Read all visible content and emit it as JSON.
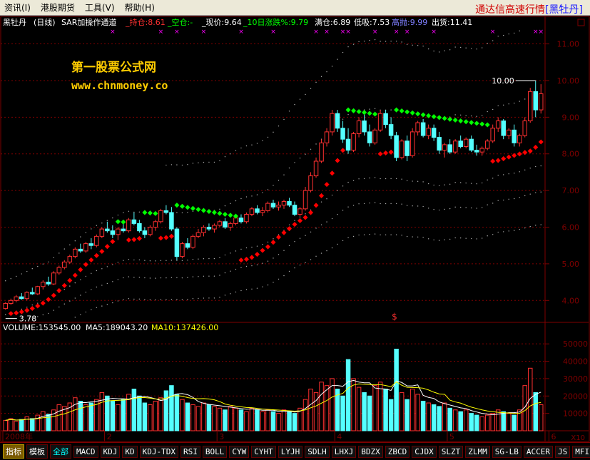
{
  "menu": [
    {
      "label": "资讯(I)"
    },
    {
      "label": "港股期货"
    },
    {
      "label": "工具(V)"
    },
    {
      "label": "帮助(H)"
    }
  ],
  "app_title": {
    "main": "通达信高速行情",
    "stock": "[黑牡丹]"
  },
  "upper_header": {
    "stock_name": "黑牡丹",
    "period": "(日线)",
    "indicator": "SAR加操作通道",
    "hold": "_持仓:8.61",
    "empty": "_空仓:-",
    "price": "_现价:9.64",
    "change10": "_10日涨跌%:9.79",
    "full": "满仓:6.89",
    "low": "低吸:7.53",
    "high_throw": "高抛:9.99",
    "out": "出货:11.41"
  },
  "watermark": {
    "line1": "第一股票公式网",
    "line2": "www.chnmoney.co"
  },
  "upper_labels": {
    "max": "10.00",
    "min": "3.78",
    "signal": "$"
  },
  "lower_header": {
    "volume": "VOLUME:153545.00",
    "ma5": "MA5:189043.20",
    "ma10": "MA10:137426.00"
  },
  "price_axis": [
    "11.00",
    "10.00",
    "9.00",
    "8.00",
    "7.00",
    "6.00",
    "5.00",
    "4.00"
  ],
  "volume_axis": [
    "50000",
    "40000",
    "30000",
    "20000",
    "10000"
  ],
  "volume_unit": "X10",
  "date_axis": [
    {
      "label": "2008年",
      "idx": 0
    },
    {
      "label": "2",
      "idx": 19
    },
    {
      "label": "3",
      "idx": 40
    },
    {
      "label": "4",
      "idx": 62
    },
    {
      "label": "5",
      "idx": 83
    },
    {
      "label": "6",
      "idx": 102
    }
  ],
  "tabs": [
    "指标",
    "模板",
    "全部",
    "MACD",
    "KDJ",
    "KD",
    "KDJ-TDX",
    "RSI",
    "BOLL",
    "CYW",
    "CYHT",
    "LYJH",
    "SDLH",
    "LHXJ",
    "BDZX",
    "ZBCD",
    "CJDX",
    "SLZT",
    "ZLMM",
    "SG-LB",
    "ACCER",
    "JS",
    "MFI"
  ],
  "colors": {
    "up": "#ff3030",
    "down": "#54ffff",
    "grid": "#800000",
    "ma5": "#ffffff",
    "ma10": "#ffff00",
    "sar_long": "#ff0000",
    "sar_short": "#00ff00",
    "marker": "#ff00ff",
    "channel": "#aaaaaa"
  },
  "chart_data": {
    "type": "candlestick",
    "price_ylim": [
      3.5,
      11.4
    ],
    "volume_ylim": [
      0,
      55000
    ],
    "series": [
      {
        "name": "candles",
        "values": [
          [
            3.78,
            3.95,
            3.75,
            3.92
          ],
          [
            3.92,
            4.05,
            3.88,
            4.0
          ],
          [
            4.0,
            4.15,
            3.95,
            4.1
          ],
          [
            4.1,
            4.2,
            4.02,
            4.05
          ],
          [
            4.05,
            4.25,
            4.0,
            4.22
          ],
          [
            4.22,
            4.35,
            4.15,
            4.18
          ],
          [
            4.18,
            4.4,
            4.15,
            4.38
          ],
          [
            4.38,
            4.55,
            4.3,
            4.5
          ],
          [
            4.5,
            4.65,
            4.4,
            4.45
          ],
          [
            4.45,
            4.8,
            4.42,
            4.75
          ],
          [
            4.75,
            4.95,
            4.7,
            4.9
          ],
          [
            4.9,
            5.1,
            4.85,
            5.05
          ],
          [
            5.05,
            5.25,
            5.0,
            5.2
          ],
          [
            5.2,
            5.45,
            5.15,
            5.4
          ],
          [
            5.4,
            5.55,
            5.3,
            5.35
          ],
          [
            5.35,
            5.6,
            5.3,
            5.55
          ],
          [
            5.55,
            5.7,
            5.4,
            5.5
          ],
          [
            5.5,
            5.8,
            5.45,
            5.75
          ],
          [
            5.75,
            6.0,
            5.7,
            5.95
          ],
          [
            5.95,
            6.15,
            5.85,
            5.9
          ],
          [
            5.9,
            6.05,
            5.7,
            5.8
          ],
          [
            5.8,
            6.0,
            5.65,
            5.95
          ],
          [
            5.95,
            6.1,
            5.85,
            5.9
          ],
          [
            5.9,
            6.25,
            5.85,
            6.2
          ],
          [
            6.2,
            6.4,
            6.05,
            6.1
          ],
          [
            6.1,
            6.2,
            5.85,
            5.9
          ],
          [
            5.9,
            6.0,
            5.7,
            5.8
          ],
          [
            5.8,
            6.05,
            5.75,
            6.0
          ],
          [
            6.0,
            6.2,
            5.9,
            6.15
          ],
          [
            6.15,
            6.5,
            6.1,
            6.45
          ],
          [
            6.45,
            6.6,
            6.35,
            6.4
          ],
          [
            6.4,
            6.55,
            5.9,
            5.95
          ],
          [
            5.95,
            6.0,
            5.1,
            5.2
          ],
          [
            5.2,
            5.6,
            5.15,
            5.55
          ],
          [
            5.55,
            5.7,
            5.4,
            5.45
          ],
          [
            5.45,
            5.8,
            5.4,
            5.75
          ],
          [
            5.75,
            5.95,
            5.7,
            5.85
          ],
          [
            5.85,
            6.05,
            5.75,
            6.0
          ],
          [
            6.0,
            6.1,
            5.9,
            5.95
          ],
          [
            5.95,
            6.1,
            5.85,
            6.05
          ],
          [
            6.05,
            6.2,
            6.0,
            6.15
          ],
          [
            6.15,
            6.25,
            5.95,
            6.0
          ],
          [
            6.0,
            6.15,
            5.9,
            6.1
          ],
          [
            6.1,
            6.3,
            6.05,
            6.25
          ],
          [
            6.25,
            6.35,
            6.1,
            6.15
          ],
          [
            6.15,
            6.4,
            6.1,
            6.35
          ],
          [
            6.35,
            6.55,
            6.3,
            6.5
          ],
          [
            6.5,
            6.6,
            6.35,
            6.4
          ],
          [
            6.4,
            6.55,
            6.3,
            6.45
          ],
          [
            6.45,
            6.7,
            6.4,
            6.65
          ],
          [
            6.65,
            6.75,
            6.5,
            6.55
          ],
          [
            6.55,
            6.7,
            6.45,
            6.6
          ],
          [
            6.6,
            6.75,
            6.5,
            6.7
          ],
          [
            6.7,
            6.8,
            6.55,
            6.6
          ],
          [
            6.6,
            6.7,
            6.3,
            6.35
          ],
          [
            6.35,
            6.55,
            6.3,
            6.5
          ],
          [
            6.5,
            7.1,
            6.45,
            7.0
          ],
          [
            7.0,
            7.5,
            6.95,
            7.4
          ],
          [
            7.4,
            7.9,
            7.35,
            7.8
          ],
          [
            7.8,
            8.4,
            7.75,
            8.3
          ],
          [
            8.3,
            8.7,
            8.2,
            8.6
          ],
          [
            8.6,
            9.2,
            8.5,
            9.1
          ],
          [
            9.1,
            9.2,
            8.6,
            8.7
          ],
          [
            8.7,
            8.9,
            8.3,
            8.4
          ],
          [
            8.4,
            8.7,
            8.0,
            8.1
          ],
          [
            8.1,
            8.6,
            8.05,
            8.55
          ],
          [
            8.55,
            9.0,
            8.45,
            8.9
          ],
          [
            8.9,
            9.1,
            8.5,
            8.6
          ],
          [
            8.6,
            8.8,
            8.2,
            8.3
          ],
          [
            8.3,
            8.7,
            8.25,
            8.65
          ],
          [
            8.65,
            9.2,
            8.6,
            9.1
          ],
          [
            9.1,
            9.2,
            8.7,
            8.8
          ],
          [
            8.8,
            9.0,
            8.4,
            8.5
          ],
          [
            8.5,
            8.6,
            7.8,
            7.9
          ],
          [
            7.9,
            8.4,
            7.85,
            8.35
          ],
          [
            8.35,
            8.5,
            7.8,
            7.95
          ],
          [
            7.95,
            8.7,
            7.9,
            8.6
          ],
          [
            8.6,
            8.9,
            8.5,
            8.85
          ],
          [
            8.85,
            8.95,
            8.45,
            8.5
          ],
          [
            8.5,
            8.8,
            8.4,
            8.7
          ],
          [
            8.7,
            8.8,
            8.35,
            8.45
          ],
          [
            8.45,
            8.6,
            8.0,
            8.1
          ],
          [
            8.1,
            8.3,
            7.9,
            8.25
          ],
          [
            8.25,
            8.4,
            8.0,
            8.05
          ],
          [
            8.05,
            8.4,
            8.0,
            8.35
          ],
          [
            8.35,
            8.5,
            8.15,
            8.2
          ],
          [
            8.2,
            8.45,
            8.15,
            8.4
          ],
          [
            8.4,
            8.5,
            8.05,
            8.1
          ],
          [
            8.1,
            8.25,
            7.95,
            8.05
          ],
          [
            8.05,
            8.2,
            7.95,
            8.15
          ],
          [
            8.15,
            8.4,
            8.1,
            8.35
          ],
          [
            8.35,
            8.8,
            8.3,
            8.7
          ],
          [
            8.7,
            9.0,
            8.6,
            8.9
          ],
          [
            8.9,
            8.95,
            8.4,
            8.5
          ],
          [
            8.5,
            8.7,
            8.4,
            8.65
          ],
          [
            8.65,
            8.8,
            8.2,
            8.3
          ],
          [
            8.3,
            8.55,
            8.2,
            8.5
          ],
          [
            8.5,
            9.0,
            8.45,
            8.9
          ],
          [
            8.9,
            9.8,
            8.85,
            9.7
          ],
          [
            9.7,
            10.0,
            9.0,
            9.2
          ],
          [
            9.2,
            9.9,
            9.1,
            9.64
          ]
        ]
      },
      {
        "name": "volume",
        "values": [
          6000,
          7000,
          5500,
          6500,
          8000,
          7000,
          9000,
          11000,
          9500,
          12000,
          15000,
          14000,
          16000,
          19000,
          17000,
          15000,
          16000,
          18000,
          22000,
          20000,
          17000,
          15000,
          18000,
          21000,
          24000,
          20000,
          16000,
          15000,
          17000,
          19000,
          23000,
          26000,
          21000,
          18000,
          16000,
          15000,
          14000,
          16000,
          15000,
          14000,
          13000,
          12000,
          14000,
          13000,
          12000,
          11000,
          13000,
          12000,
          11000,
          12000,
          11000,
          10000,
          12000,
          11000,
          10000,
          13000,
          18000,
          24000,
          22000,
          28000,
          26000,
          30000,
          24000,
          20000,
          41000,
          30000,
          25000,
          22000,
          20000,
          26000,
          28000,
          24000,
          18000,
          47000,
          22000,
          18000,
          24000,
          21000,
          17000,
          16000,
          15000,
          14000,
          16000,
          13000,
          12000,
          11000,
          12000,
          10000,
          9000,
          8000,
          9000,
          10000,
          12000,
          11000,
          10000,
          9000,
          12000,
          26000,
          36000,
          22000,
          15000
        ]
      }
    ]
  }
}
